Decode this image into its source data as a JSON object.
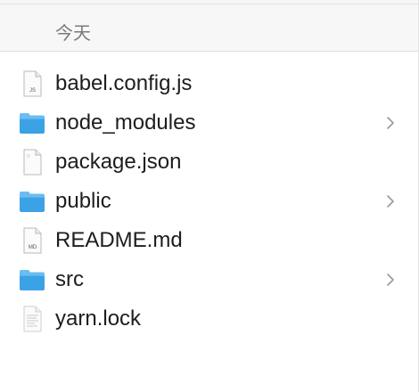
{
  "section": {
    "label": "今天"
  },
  "files": [
    {
      "name": "babel.config.js",
      "kind": "file",
      "badge": "JS",
      "icon": "js-file-icon"
    },
    {
      "name": "node_modules",
      "kind": "folder",
      "icon": "folder-icon"
    },
    {
      "name": "package.json",
      "kind": "file",
      "badge": "",
      "icon": "json-file-icon"
    },
    {
      "name": "public",
      "kind": "folder",
      "icon": "folder-icon"
    },
    {
      "name": "README.md",
      "kind": "file",
      "badge": "MD",
      "icon": "md-file-icon"
    },
    {
      "name": "src",
      "kind": "folder",
      "icon": "folder-icon"
    },
    {
      "name": "yarn.lock",
      "kind": "file",
      "badge": "",
      "icon": "text-file-icon"
    }
  ],
  "colors": {
    "folder_blue": "#3ba2e6",
    "folder_tab": "#6bbcf2",
    "text": "#1d1d1d",
    "header_text": "#7a7a7a",
    "chevron": "#9a9a9a"
  }
}
